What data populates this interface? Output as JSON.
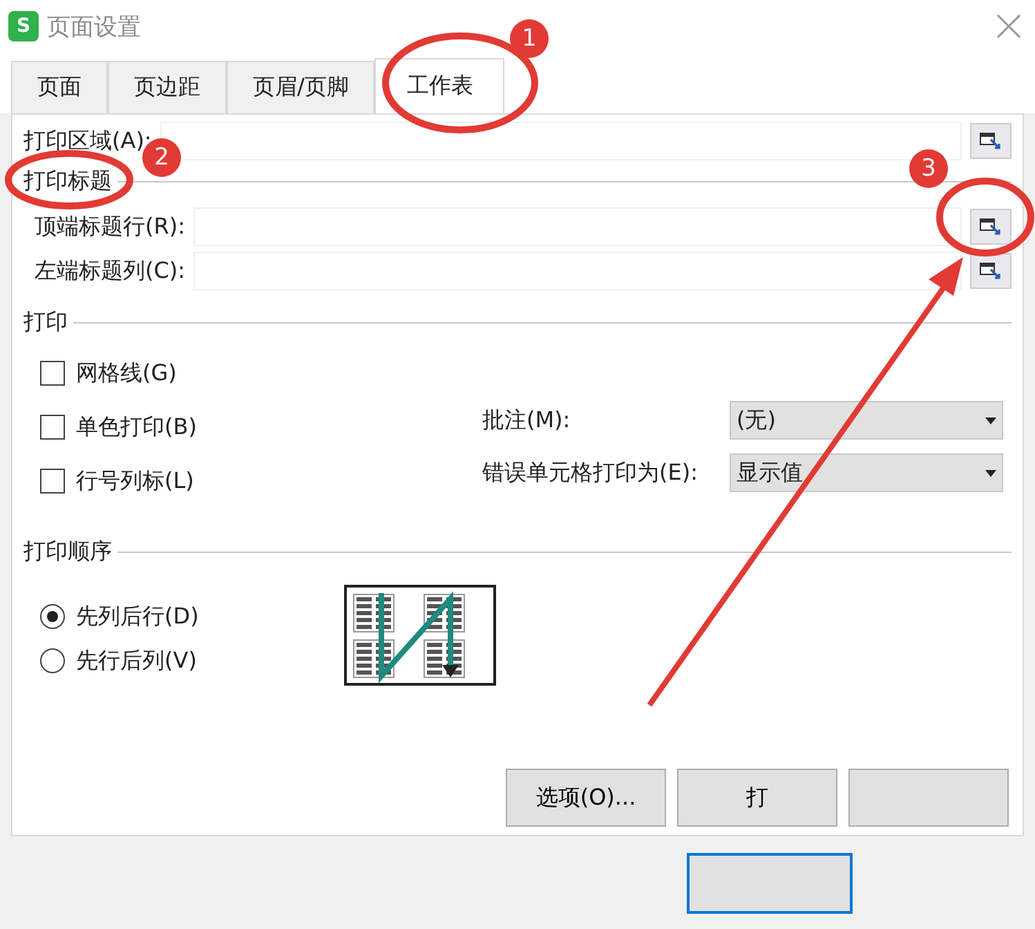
{
  "window": {
    "title": "页面设置",
    "app_icon": "S"
  },
  "tabs": [
    {
      "label": "页面",
      "selected": false
    },
    {
      "label": "页边距",
      "selected": false
    },
    {
      "label": "页眉/页脚",
      "selected": false
    },
    {
      "label": "工作表",
      "selected": true
    }
  ],
  "print_area": {
    "label": "打印区域(A):"
  },
  "print_titles": {
    "heading": "打印标题",
    "rows": [
      {
        "label": "顶端标题行(R):"
      },
      {
        "label": "左端标题列(C):"
      }
    ]
  },
  "print": {
    "heading": "打印",
    "options": [
      {
        "label": "网格线(G)",
        "checked": false
      },
      {
        "label": "单色打印(B)",
        "checked": false
      },
      {
        "label": "行号列标(L)",
        "checked": false
      }
    ],
    "selects": [
      {
        "label": "批注(M):",
        "value": "(无)"
      },
      {
        "label": "错误单元格打印为(E):",
        "value": "显示值"
      }
    ]
  },
  "print_order": {
    "heading": "打印顺序",
    "options": [
      {
        "label": "先列后行(D)",
        "selected": true
      },
      {
        "label": "先行后列(V)",
        "selected": false
      }
    ]
  },
  "buttons": [
    "选项(O)...",
    "打"
  ],
  "annotations": [
    {
      "number": "1"
    },
    {
      "number": "2"
    },
    {
      "number": "3"
    }
  ]
}
